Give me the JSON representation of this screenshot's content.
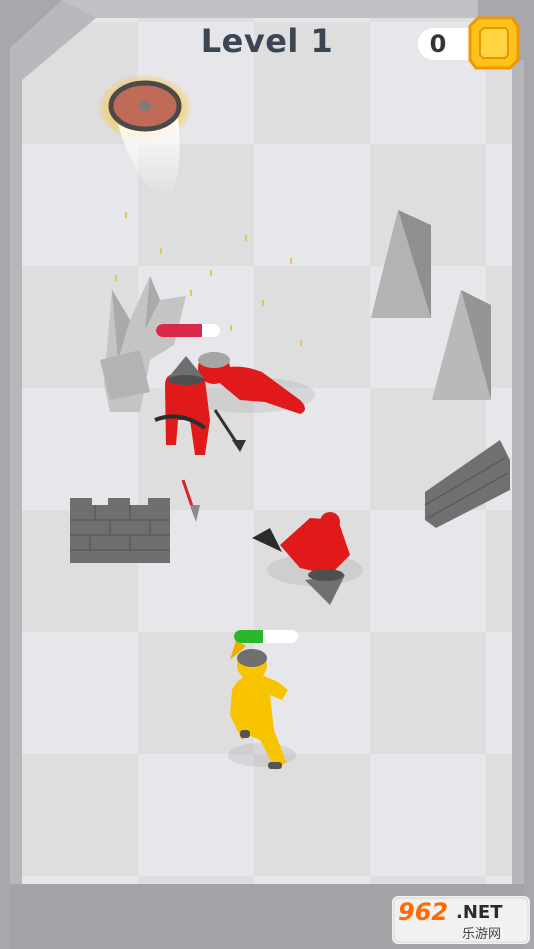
{
  "hud": {
    "level_label": "Level 1",
    "coin_count": "0"
  },
  "player": {
    "health": 0.45,
    "health_color": "#2ab52a"
  },
  "enemy": {
    "health": 0.72,
    "health_color": "#d9284a"
  },
  "colors": {
    "floor_light": "#e9e9ed",
    "floor_dark": "#dcdce1",
    "wall": "#b3b3b8",
    "player_body": "#f8c400",
    "enemy_body": "#e01a1a",
    "coin": "#ffc21a"
  },
  "watermark": {
    "brand": "962",
    "suffix": ".NET",
    "subtitle": "乐游网"
  }
}
